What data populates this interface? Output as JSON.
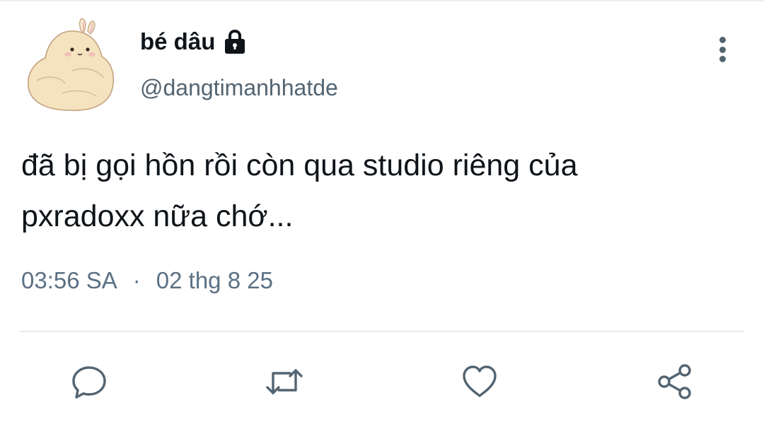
{
  "tweet": {
    "author": {
      "display_name": "bé dâu",
      "handle": "@dangtimanhhatde",
      "protected_icon": "lock-icon",
      "avatar_icon": "bunny-blob-avatar"
    },
    "text": "đã bị gọi hồn rồi còn qua studio riêng của\npxradoxx nữa chớ...",
    "time": "03:56 SA",
    "separator": "·",
    "date": "02 thg 8 25",
    "menu_icon": "more-vertical-icon",
    "actions": [
      {
        "icon": "reply-icon"
      },
      {
        "icon": "retweet-icon"
      },
      {
        "icon": "like-icon"
      },
      {
        "icon": "share-icon"
      }
    ],
    "colors": {
      "text": "#0f1419",
      "secondary": "#536471",
      "divider": "#e6ecf0",
      "avatar_fill": "#f5e3c0"
    }
  }
}
